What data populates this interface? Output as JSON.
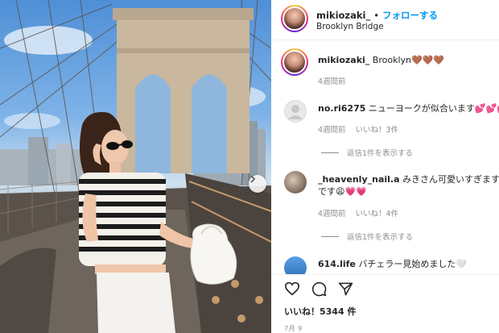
{
  "post": {
    "username": "mikiozaki_",
    "separator": "•",
    "follow_label": "フォローする",
    "location": "Brooklyn Bridge"
  },
  "caption": {
    "username": "mikiozaki_",
    "text": "Brooklyn🤎🤎🤎",
    "time": "4週間前"
  },
  "comments": [
    {
      "username": "no.ri6275",
      "text": "ニューヨークが似合います💕💕💕",
      "time": "4週間前",
      "likes": "いいね！3件",
      "replies": "返信1件を表示する"
    },
    {
      "username": "_heavenly_nail.a",
      "text": "みきさん可愛いすぎます❤",
      "text2": "です😩💗💗",
      "time": "4週間前",
      "likes": "いいね！4件",
      "replies": "返信1件を表示する"
    },
    {
      "username": "614.life",
      "text": "バチェラー見始めました🤍"
    }
  ],
  "likes_count": "いいね！5344 件",
  "date": "7月 9",
  "icons": {
    "like": "heart-icon",
    "comment": "comment-icon",
    "share": "share-icon",
    "next": "chevron-right-icon"
  }
}
